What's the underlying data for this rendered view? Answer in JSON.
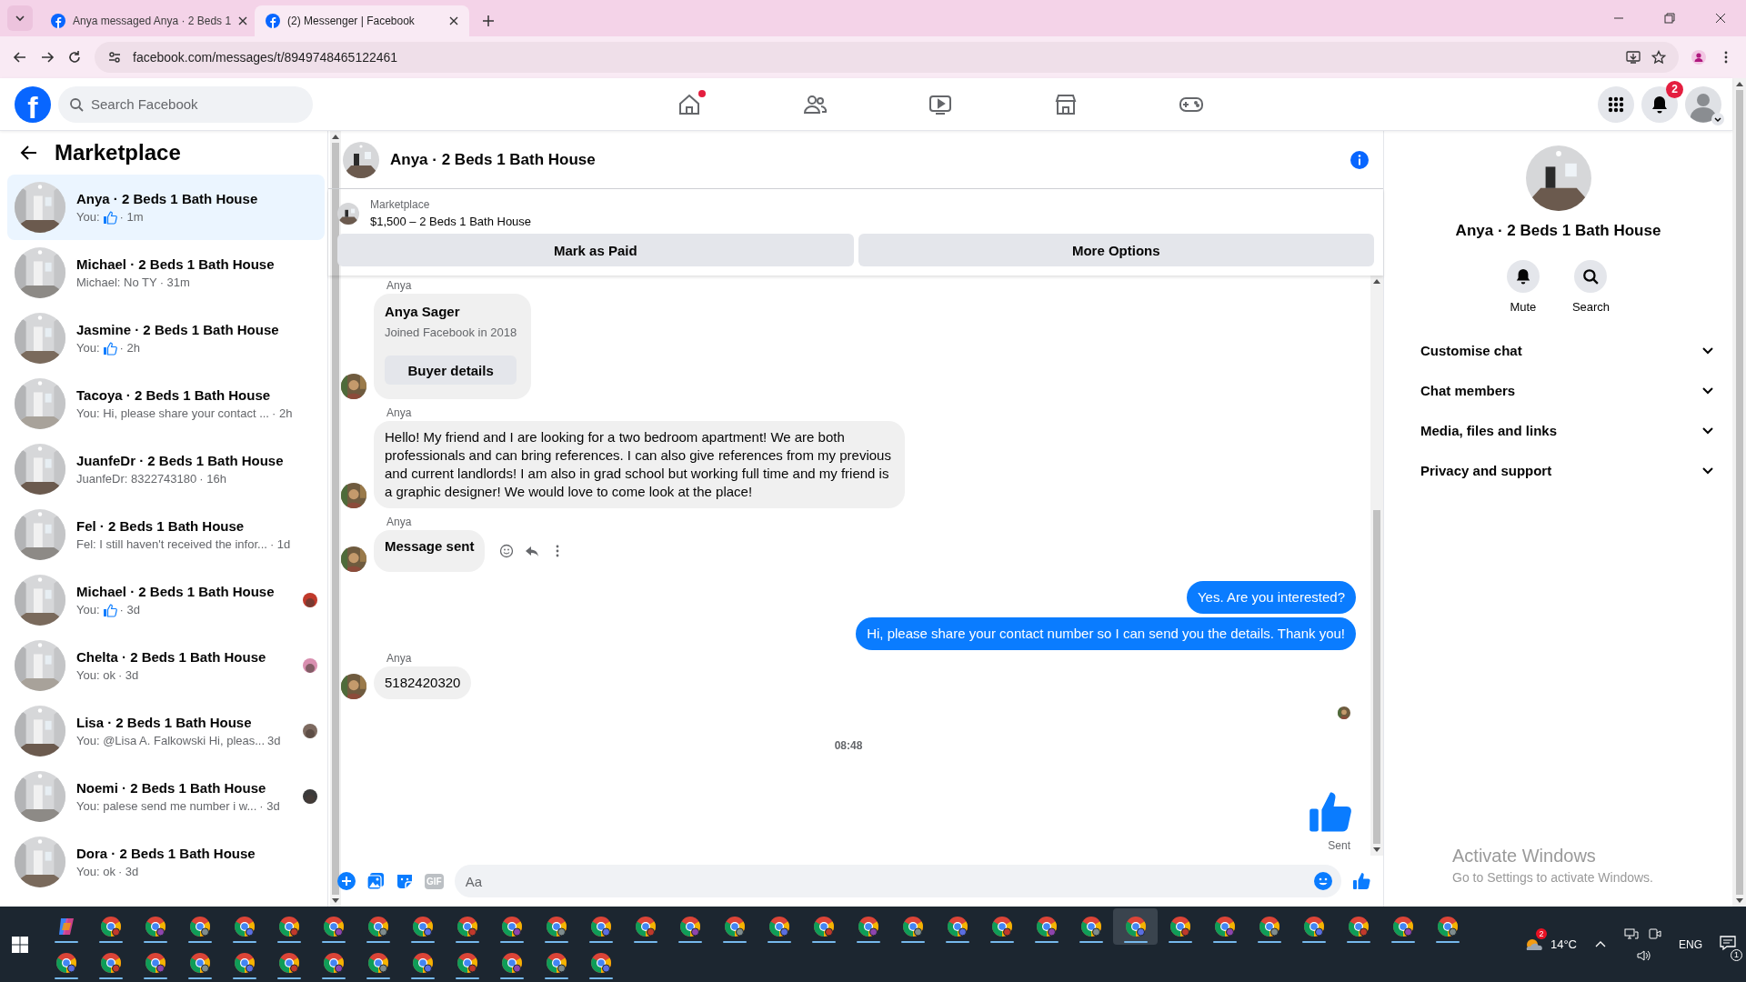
{
  "browser": {
    "tabs": [
      {
        "title": "Anya messaged Anya · 2 Beds 1",
        "selected": false
      },
      {
        "title": "(2) Messenger | Facebook",
        "selected": true
      }
    ],
    "url": "facebook.com/messages/t/8949748465122461"
  },
  "header": {
    "logo": "f",
    "search": {
      "placeholder": "Search Facebook"
    },
    "nav": [
      {
        "kind": "home",
        "dot": true
      },
      {
        "kind": "friends",
        "dot": false
      },
      {
        "kind": "video",
        "dot": false
      },
      {
        "kind": "marketplace",
        "dot": false
      },
      {
        "kind": "gaming",
        "dot": false
      }
    ],
    "notification_count": "2"
  },
  "sidebar": {
    "title": "Marketplace",
    "conversations": [
      {
        "title": "Anya · 2 Beds 1 Bath House",
        "preview": "You:",
        "like": true,
        "time": "· 1m",
        "selected": true,
        "seen": false
      },
      {
        "title": "Michael · 2 Beds 1 Bath House",
        "preview": "Michael: No TY",
        "like": false,
        "time": "· 31m",
        "selected": false,
        "seen": false
      },
      {
        "title": "Jasmine · 2 Beds 1 Bath House",
        "preview": "You:",
        "like": true,
        "time": "· 2h",
        "selected": false,
        "seen": false
      },
      {
        "title": "Tacoya · 2 Beds 1 Bath House",
        "preview": "You: Hi, please share your contact ...",
        "like": false,
        "time": "· 2h",
        "selected": false,
        "seen": false
      },
      {
        "title": "JuanfeDr · 2 Beds 1 Bath House",
        "preview": "JuanfeDr: 8322743180",
        "like": false,
        "time": "· 16h",
        "selected": false,
        "seen": false
      },
      {
        "title": "Fel · 2 Beds 1 Bath House",
        "preview": "Fel: I still haven't received the infor...",
        "like": false,
        "time": "· 1d",
        "selected": false,
        "seen": false
      },
      {
        "title": "Michael · 2 Beds 1 Bath House",
        "preview": "You:",
        "like": true,
        "time": "· 3d",
        "selected": false,
        "seen": true
      },
      {
        "title": "Chelta · 2 Beds 1 Bath House",
        "preview": "You: ok",
        "like": false,
        "time": "· 3d",
        "selected": false,
        "seen": true
      },
      {
        "title": "Lisa · 2 Beds 1 Bath House",
        "preview": "You: @Lisa A. Falkowski Hi, pleas...",
        "like": false,
        "time": "3d",
        "selected": false,
        "seen": true
      },
      {
        "title": "Noemi · 2 Beds 1 Bath House",
        "preview": "You: palese send me number i w...",
        "like": false,
        "time": "· 3d",
        "selected": false,
        "seen": true
      },
      {
        "title": "Dora · 2 Beds 1 Bath House",
        "preview": "You: ok",
        "like": false,
        "time": "· 3d",
        "selected": false,
        "seen": false
      }
    ]
  },
  "chat": {
    "title": "Anya · 2 Beds 1 Bath House",
    "listing": {
      "label": "Marketplace",
      "price": "$1,500 – 2 Beds 1 Bath House",
      "buttons": [
        "Mark as Paid",
        "More Options"
      ]
    },
    "messages": [
      {
        "kind": "profile",
        "sender": "Anya",
        "name": "Anya Sager",
        "subtitle": "Joined Facebook in 2018",
        "button": "Buyer details"
      },
      {
        "kind": "incoming",
        "sender": "Anya",
        "text": "Hello! My friend and I are looking for a two bedroom apartment! We are both professionals and can bring references. I can also give references from my previous and current landlords! I am also in grad school but working full time and my friend is a graphic designer! We would love to come look at the place!",
        "bold": false,
        "actions": false
      },
      {
        "kind": "incoming",
        "sender": "Anya",
        "text": "Message sent",
        "bold": true,
        "actions": true
      },
      {
        "kind": "outgoing",
        "text": "Yes. Are you interested?"
      },
      {
        "kind": "outgoing",
        "text": "Hi, please share your contact number so I can send you the details. Thank you!"
      },
      {
        "kind": "incoming",
        "sender": "Anya",
        "text": "5182420320",
        "bold": false,
        "actions": false
      },
      {
        "kind": "seen"
      },
      {
        "kind": "time",
        "text": "08:48"
      },
      {
        "kind": "like",
        "status": "Sent"
      }
    ],
    "composer": {
      "gif": "GIF",
      "placeholder": "Aa"
    }
  },
  "details": {
    "title": "Anya · 2 Beds 1 Bath House",
    "actions": [
      {
        "kind": "mute",
        "label": "Mute"
      },
      {
        "kind": "search",
        "label": "Search"
      }
    ],
    "sections": [
      {
        "label": "Customise chat",
        "expanded": false
      },
      {
        "label": "Chat members",
        "expanded": false
      },
      {
        "label": "Media, files and links",
        "expanded": false
      },
      {
        "label": "Privacy and support",
        "expanded": false
      }
    ]
  },
  "activation_notice": {
    "title": "Activate Windows",
    "text": "Go to Settings to activate Windows."
  },
  "taskbar": {
    "apps": [
      {
        "kind": "copilot",
        "selected": false
      },
      {
        "kind": "browser",
        "selected": false
      },
      {
        "kind": "browser",
        "selected": false
      },
      {
        "kind": "browser",
        "selected": false
      },
      {
        "kind": "browser",
        "selected": false
      },
      {
        "kind": "browser",
        "selected": false
      },
      {
        "kind": "browser",
        "selected": false
      },
      {
        "kind": "browser",
        "selected": false
      },
      {
        "kind": "browser",
        "selected": false
      },
      {
        "kind": "browser",
        "selected": false
      },
      {
        "kind": "browser",
        "selected": false
      },
      {
        "kind": "browser",
        "selected": false
      },
      {
        "kind": "browser",
        "selected": false
      },
      {
        "kind": "browser",
        "selected": false
      },
      {
        "kind": "browser",
        "selected": false
      },
      {
        "kind": "browser",
        "selected": false
      },
      {
        "kind": "browser",
        "selected": false
      },
      {
        "kind": "browser",
        "selected": false
      },
      {
        "kind": "browser",
        "selected": false
      },
      {
        "kind": "browser",
        "selected": false
      },
      {
        "kind": "browser",
        "selected": false
      },
      {
        "kind": "browser",
        "selected": false
      },
      {
        "kind": "browser",
        "selected": false
      },
      {
        "kind": "browser",
        "selected": false
      },
      {
        "kind": "browser",
        "selected": true
      },
      {
        "kind": "browser",
        "selected": false
      },
      {
        "kind": "browser",
        "selected": false
      },
      {
        "kind": "browser",
        "selected": false
      },
      {
        "kind": "browser",
        "selected": false
      },
      {
        "kind": "browser",
        "selected": false
      },
      {
        "kind": "browser",
        "selected": false
      },
      {
        "kind": "browser",
        "selected": false
      },
      {
        "kind": "browser",
        "selected": false
      },
      {
        "kind": "browser",
        "selected": false
      },
      {
        "kind": "browser",
        "selected": false
      },
      {
        "kind": "browser",
        "selected": false
      },
      {
        "kind": "browser",
        "selected": false
      },
      {
        "kind": "browser",
        "selected": false
      },
      {
        "kind": "browser",
        "selected": false
      },
      {
        "kind": "browser",
        "selected": false
      },
      {
        "kind": "browser",
        "selected": false
      },
      {
        "kind": "browser",
        "selected": false
      },
      {
        "kind": "browser",
        "selected": false
      },
      {
        "kind": "browser",
        "selected": false
      },
      {
        "kind": "browser",
        "selected": false
      }
    ],
    "weather": {
      "badge": "2",
      "temperature": "14°C"
    },
    "language": "ENG",
    "notifications": "1"
  }
}
